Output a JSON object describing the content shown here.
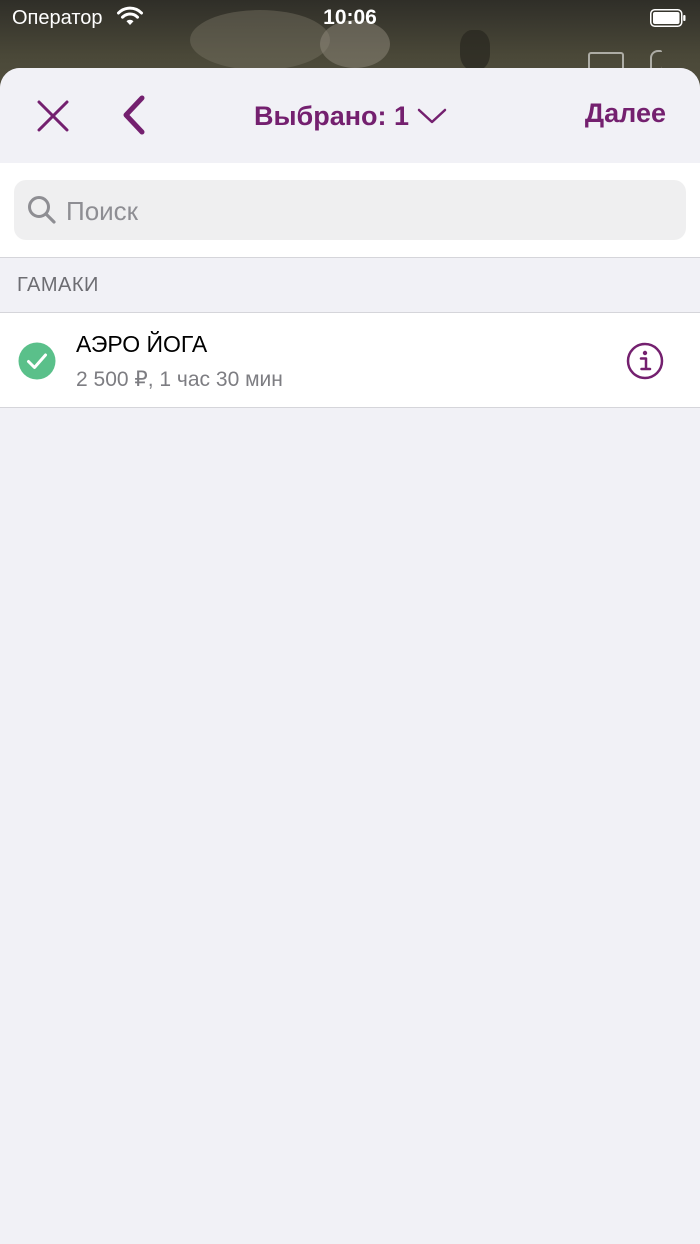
{
  "status_bar": {
    "carrier": "Оператор",
    "time": "10:06"
  },
  "header": {
    "close_icon": "close-icon",
    "back_icon": "chevron-left-icon",
    "selected_label": "Выбрано: 1",
    "dropdown_icon": "chevron-down-icon",
    "next_label": "Далее"
  },
  "search": {
    "placeholder": "Поиск",
    "value": ""
  },
  "sections": [
    {
      "title": "ГАМАКИ",
      "items": [
        {
          "name": "АЭРО ЙОГА",
          "details": "2 500 ₽, 1 час 30 мин",
          "selected": true
        }
      ]
    }
  ],
  "colors": {
    "accent": "#74206f",
    "check": "#5ac08a",
    "background": "#f1f1f6"
  }
}
